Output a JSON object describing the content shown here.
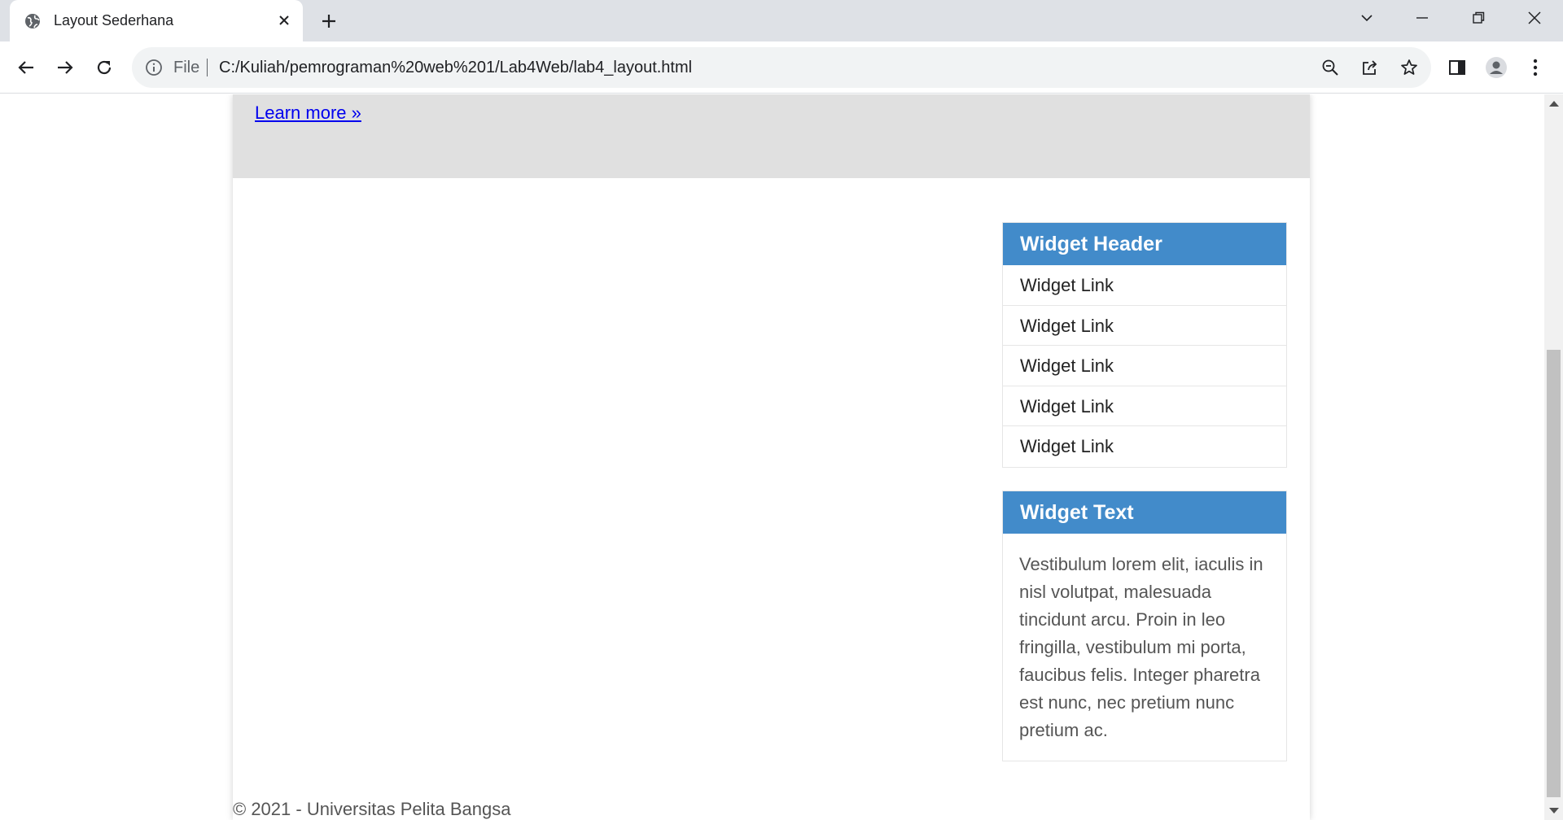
{
  "browser": {
    "tab_title": "Layout Sederhana",
    "scheme_label": "File",
    "url": "C:/Kuliah/pemrograman%20web%201/Lab4Web/lab4_layout.html"
  },
  "page": {
    "hero_link": "Learn more »",
    "widget_links": {
      "header": "Widget Header",
      "items": [
        "Widget Link",
        "Widget Link",
        "Widget Link",
        "Widget Link",
        "Widget Link"
      ]
    },
    "widget_text": {
      "header": "Widget Text",
      "body": "Vestibulum lorem elit, iaculis in nisl volutpat, malesuada tincidunt arcu. Proin in leo fringilla, vestibulum mi porta, faucibus felis. Integer pharetra est nunc, nec pretium nunc pretium ac."
    },
    "footer": "© 2021 - Universitas Pelita Bangsa"
  },
  "colors": {
    "widget_header_bg": "#428bca",
    "hero_bg": "#e0e0e0",
    "link": "#0000ee"
  }
}
